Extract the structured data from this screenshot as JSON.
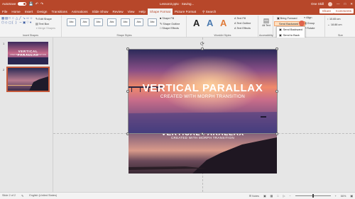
{
  "titlebar": {
    "autosave_label": "AutoSave",
    "autosave_state": "Off",
    "doc_title": "Lesson3.pptx  ·  Saving...",
    "account": "One Skill"
  },
  "tabs": [
    "File",
    "Home",
    "Insert",
    "Design",
    "Transitions",
    "Animations",
    "Slide Show",
    "Review",
    "View",
    "Help",
    "Shape Format",
    "Picture Format"
  ],
  "active_tab": "Shape Format",
  "search_label": "Search",
  "share_label": "Share",
  "comments_label": "Comments",
  "ribbon": {
    "insert_shapes": {
      "label": "Insert Shapes",
      "edit_shape": "Edit Shape",
      "text_box": "Text Box",
      "merge_shapes": "Merge Shapes"
    },
    "shape_styles": {
      "label": "Shape Styles",
      "style_sample": "Abc",
      "shape_fill": "Shape Fill",
      "shape_outline": "Shape Outline",
      "shape_effects": "Shape Effects"
    },
    "wordart_styles": {
      "label": "WordArt Styles",
      "text_fill": "Text Fill",
      "text_outline": "Text Outline",
      "text_effects": "Text Effects"
    },
    "accessibility": {
      "label": "Accessibility",
      "alt_text": "Alt Text"
    },
    "arrange": {
      "bring_forward": "Bring Forward",
      "send_backward": "Send Backward",
      "align": "Align",
      "group": "Group",
      "rotate": "Rotate"
    },
    "size": {
      "label": "Size",
      "height": "10.65 cm",
      "width": "18.88 cm"
    }
  },
  "send_menu": {
    "items": [
      "Send Backward",
      "Send to Back"
    ]
  },
  "slides": [
    {
      "number": "1",
      "title": "VERTICAL PARALLAX",
      "subtitle": "CREATED WITH MORPH TRANSITION"
    },
    {
      "number": "2"
    }
  ],
  "slide_content": {
    "title": "VERTICAL PARALLAX",
    "subtitle": "CREATED WITH MORPH TRANSITION",
    "title_below": "VERTICAL PARALLAX",
    "subtitle_below": "CREATED WITH MORPH TRANSITION"
  },
  "status": {
    "slide_of": "Slide 2 of 2",
    "language": "English (United States)",
    "notes": "Notes",
    "zoom": "66%"
  },
  "colors": {
    "accent": "#b7472a",
    "ribbon_bg": "#f3f3f3"
  }
}
